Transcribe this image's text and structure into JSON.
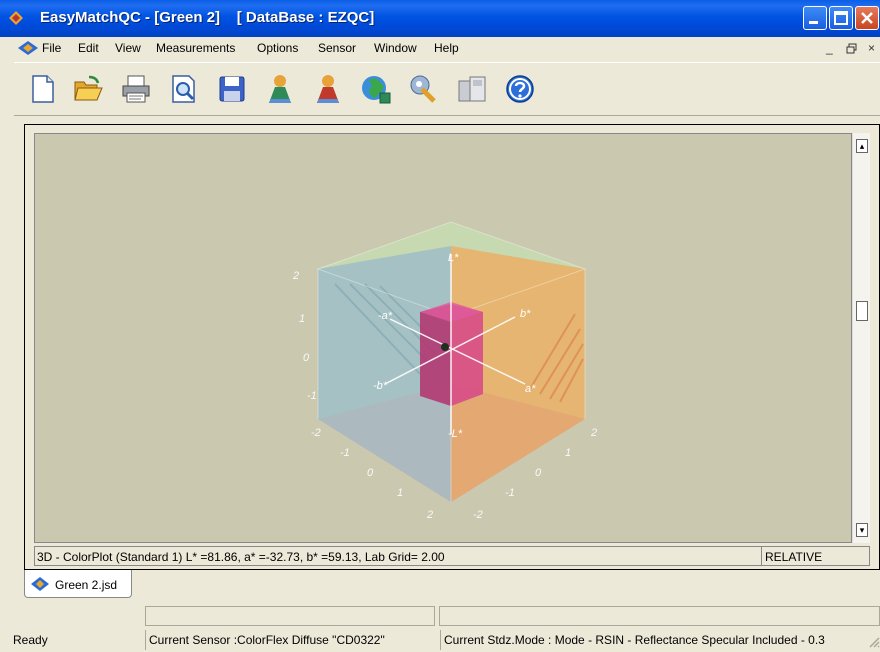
{
  "window": {
    "title": "EasyMatchQC - [Green 2]    [ DataBase : EZQC]",
    "controls": [
      "minimize",
      "maximize",
      "close"
    ]
  },
  "menu": {
    "items": [
      "File",
      "Edit",
      "View",
      "Measurements",
      "Options",
      "Sensor",
      "Window",
      "Help"
    ],
    "mdi_controls": [
      "_",
      "̅̅",
      "×"
    ]
  },
  "toolbar": {
    "icons": [
      "new-document-icon",
      "open-folder-icon",
      "print-icon",
      "print-preview-icon",
      "save-disk-icon",
      "measure-standard-icon",
      "measure-sample-icon",
      "globe-world-icon",
      "sensor-tools-icon",
      "easy-view-icon",
      "help-icon"
    ]
  },
  "plot": {
    "axis_labels": {
      "l_pos": "L*",
      "l_neg": "-L*",
      "a_pos": "a*",
      "a_neg": "-a*",
      "b_pos": "b*",
      "b_neg": "-b*"
    },
    "left_ticks": [
      "2",
      "1",
      "0",
      "-1",
      "-2"
    ],
    "front_left_ticks": [
      "-2",
      "-1",
      "0",
      "1",
      "2"
    ],
    "front_right_ticks": [
      "-2",
      "-1",
      "0",
      "1",
      "2"
    ],
    "colors": {
      "background": "#cbc8b0",
      "top_face": "#c5dab0",
      "left_face": "#a7c4c4",
      "right_face": "#e3b675",
      "inner_box": "#c0336f"
    }
  },
  "infobar": {
    "text": "3D - ColorPlot (Standard 1) L* =81.86, a* =-32.73, b* =59.13, Lab Grid= 2.00",
    "mode": "RELATIVE"
  },
  "tab": {
    "label": "Green 2.jsd"
  },
  "status": {
    "ready": "Ready",
    "sensor": "Current Sensor :ColorFlex Diffuse \"CD0322\"",
    "stdz": "Current Stdz.Mode :  Mode - RSIN - Reflectance Specular Included - 0.3"
  }
}
